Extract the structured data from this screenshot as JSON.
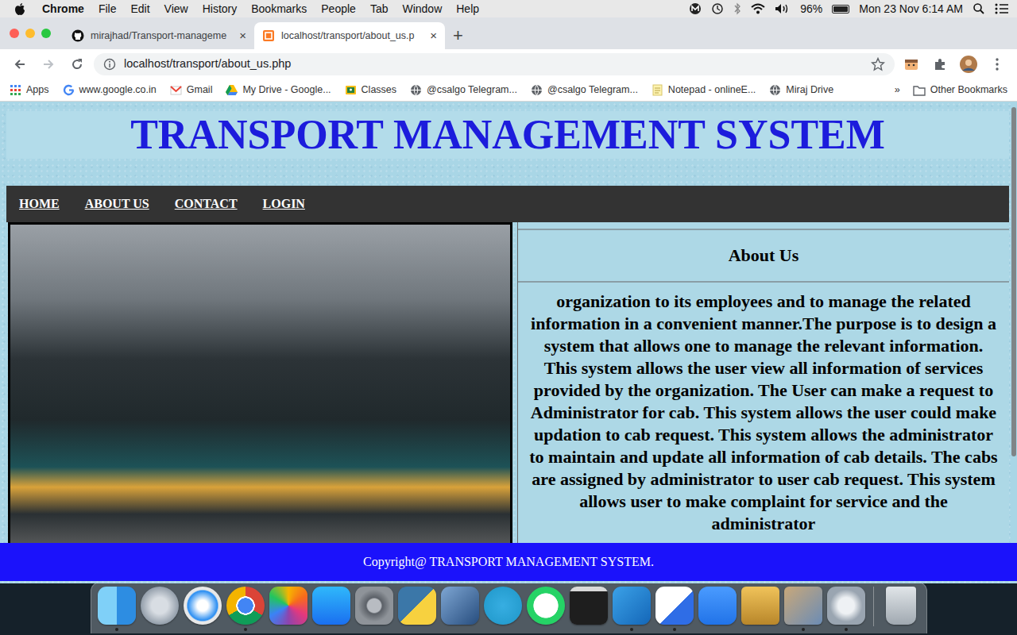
{
  "menu_bar": {
    "app": "Chrome",
    "items": [
      "File",
      "Edit",
      "View",
      "History",
      "Bookmarks",
      "People",
      "Tab",
      "Window",
      "Help"
    ],
    "battery": "96%",
    "battery_level": 0.96,
    "clock": "Mon 23 Nov 6:14 AM"
  },
  "browser": {
    "tabs": [
      {
        "label": "mirajhad/Transport-manageme",
        "close": "×",
        "selected": false
      },
      {
        "label": "localhost/transport/about_us.p",
        "close": "×",
        "selected": true
      }
    ],
    "new_tab": "+",
    "address": "localhost/transport/about_us.php",
    "bookmarks": [
      "Apps",
      "www.google.co.in",
      "Gmail",
      "My Drive - Google...",
      "Classes",
      "@csalgo Telegram...",
      "@csalgo Telegram...",
      "Notepad - onlineE...",
      "Miraj Drive"
    ],
    "more": "»",
    "other_bookmarks": "Other Bookmarks"
  },
  "page": {
    "title": "TRANSPORT MANAGEMENT SYSTEM",
    "nav": [
      "HOME",
      "ABOUT US",
      "CONTACT",
      "LOGIN"
    ],
    "about": {
      "heading": "About Us",
      "text": "organization to its employees and to manage the related information in a convenient manner.The purpose is to design a system that allows one to manage the relevant information. This system allows the user view all information of services provided by the organization. The User can make a request to Administrator for cab. This system allows the user could make updation to cab request. This system allows the administrator to maintain and update all information of cab details. The cabs are assigned by administrator to user cab request. This system allows user to make complaint for service and the administrator"
    },
    "footer": "Copyright@ TRANSPORT MANAGEMENT SYSTEM."
  },
  "dock": {
    "apps": [
      {
        "running": true
      },
      {
        "running": false
      },
      {
        "running": false
      },
      {
        "running": true
      },
      {
        "running": false
      },
      {
        "running": false
      },
      {
        "running": false
      },
      {
        "running": false
      },
      {
        "running": false
      },
      {
        "running": false
      },
      {
        "running": false
      },
      {
        "running": false
      },
      {
        "running": true
      },
      {
        "running": true
      },
      {
        "running": false
      },
      {
        "running": false
      },
      {
        "running": true
      },
      {
        "running": true
      }
    ],
    "trash": {
      "running": false
    }
  }
}
